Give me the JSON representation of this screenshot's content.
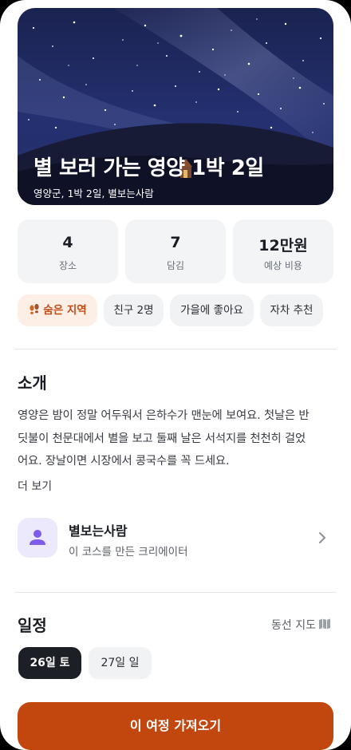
{
  "hero": {
    "title": "별 보러 가는 영양 1박 2일",
    "subtitle": "영양군, 1박 2일, 별보는사람"
  },
  "stats": [
    {
      "value": "4",
      "label": "장소"
    },
    {
      "value": "7",
      "label": "담김"
    },
    {
      "value": "12만원",
      "label": "예상 비용"
    }
  ],
  "tags": [
    {
      "label": "숨은 지역",
      "icon": "footprints-icon"
    },
    {
      "label": "친구 2명"
    },
    {
      "label": "가을에 좋아요"
    },
    {
      "label": "자차 추천"
    }
  ],
  "intro": {
    "title": "소개",
    "line1": "영양은 밤이 정말 어두워서 은하수가 맨눈에 보여요. 첫날은 반",
    "line2": "딧불이 천문대에서 별을 보고 둘째 날은 서석지를 천천히 걸었",
    "line3": "어요. 장날이면 시장에서 콩국수를 꼭 드세요.",
    "more": "더 보기"
  },
  "creator": {
    "name": "별보는사람",
    "description": "이 코스를 만든 크리에이터",
    "avatar_color": "#7c5ce8"
  },
  "schedule": {
    "title": "일정",
    "route_link": "동선 지도",
    "days": [
      "26일 토",
      "27일 일"
    ]
  },
  "cta": {
    "label": "이 여정 가져오기"
  },
  "colors": {
    "accent": "#c2470f",
    "accent_soft": "#fdeee6",
    "dark": "#1c1f26"
  }
}
